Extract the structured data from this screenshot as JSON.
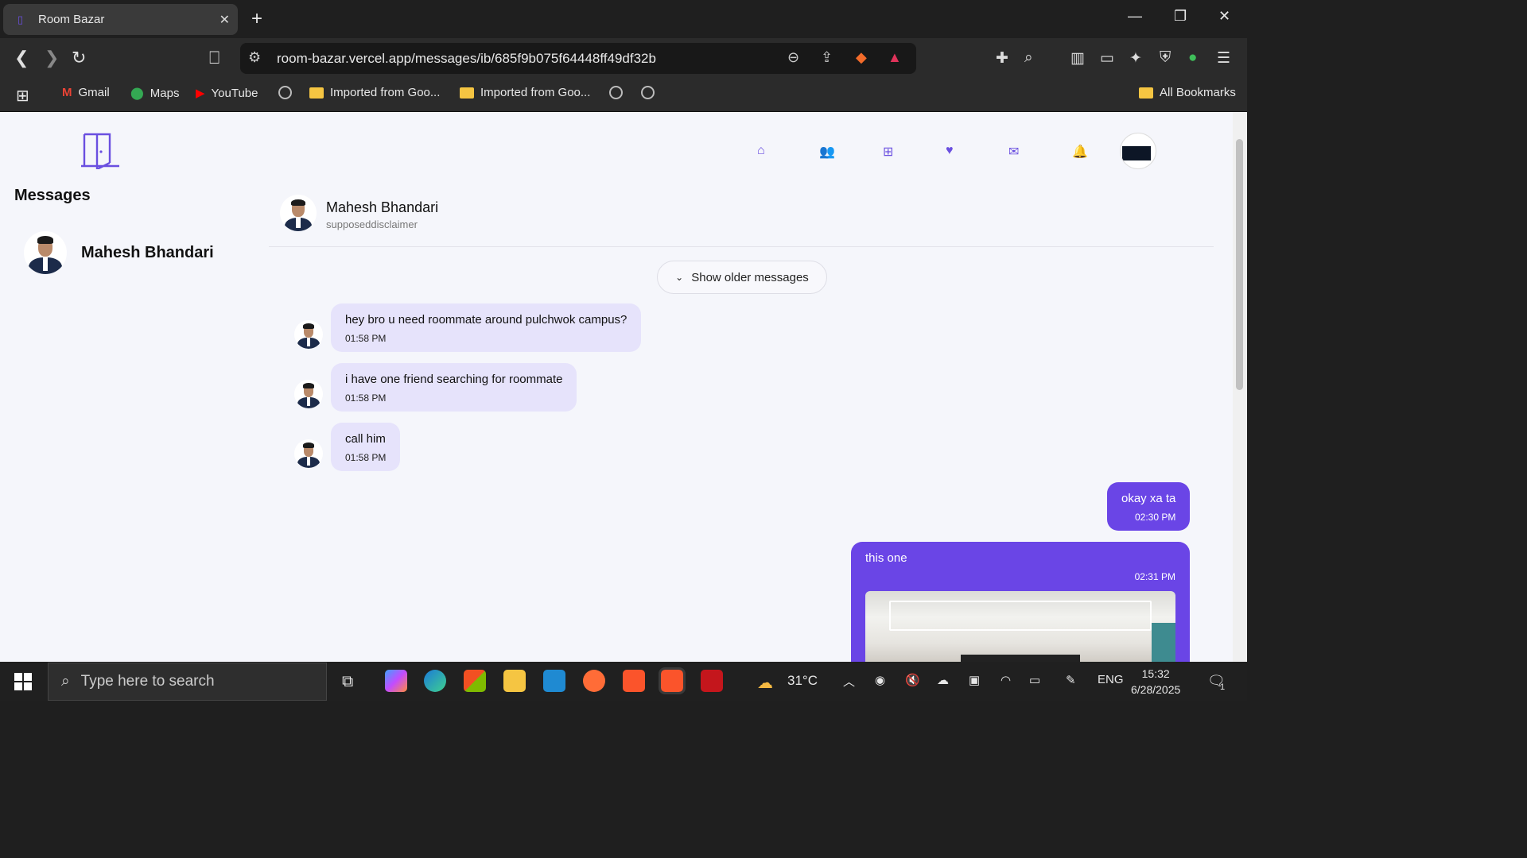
{
  "browser": {
    "tab_title": "Room Bazar",
    "url": "room-bazar.vercel.app/messages/ib/685f9b075f64448ff49df32b",
    "bookmarks": [
      "Gmail",
      "Maps",
      "YouTube",
      "Imported from Goo...",
      "Imported from Goo..."
    ],
    "all_bookmarks": "All Bookmarks"
  },
  "sidebar": {
    "title": "Messages",
    "contacts": [
      {
        "name": "Mahesh Bhandari"
      }
    ]
  },
  "chat": {
    "name": "Mahesh Bhandari",
    "username": "supposeddisclaimer",
    "show_older": "Show older messages",
    "incoming": [
      {
        "text": "hey bro u need roommate around pulchwok campus?",
        "time": "01:58 PM"
      },
      {
        "text": "i have one friend searching for roommate",
        "time": "01:58 PM"
      },
      {
        "text": "call him",
        "time": "01:58 PM"
      }
    ],
    "outgoing": [
      {
        "text": "okay xa ta",
        "time": "02:30 PM"
      },
      {
        "text": "this one",
        "time": "02:31 PM"
      }
    ]
  },
  "taskbar": {
    "search_placeholder": "Type here to search",
    "weather": "31°C",
    "lang": "ENG",
    "time": "15:32",
    "date": "6/28/2025",
    "notif_count": "1"
  },
  "colors": {
    "accent": "#6a45e6",
    "incoming_bubble": "#e6e3fb"
  }
}
